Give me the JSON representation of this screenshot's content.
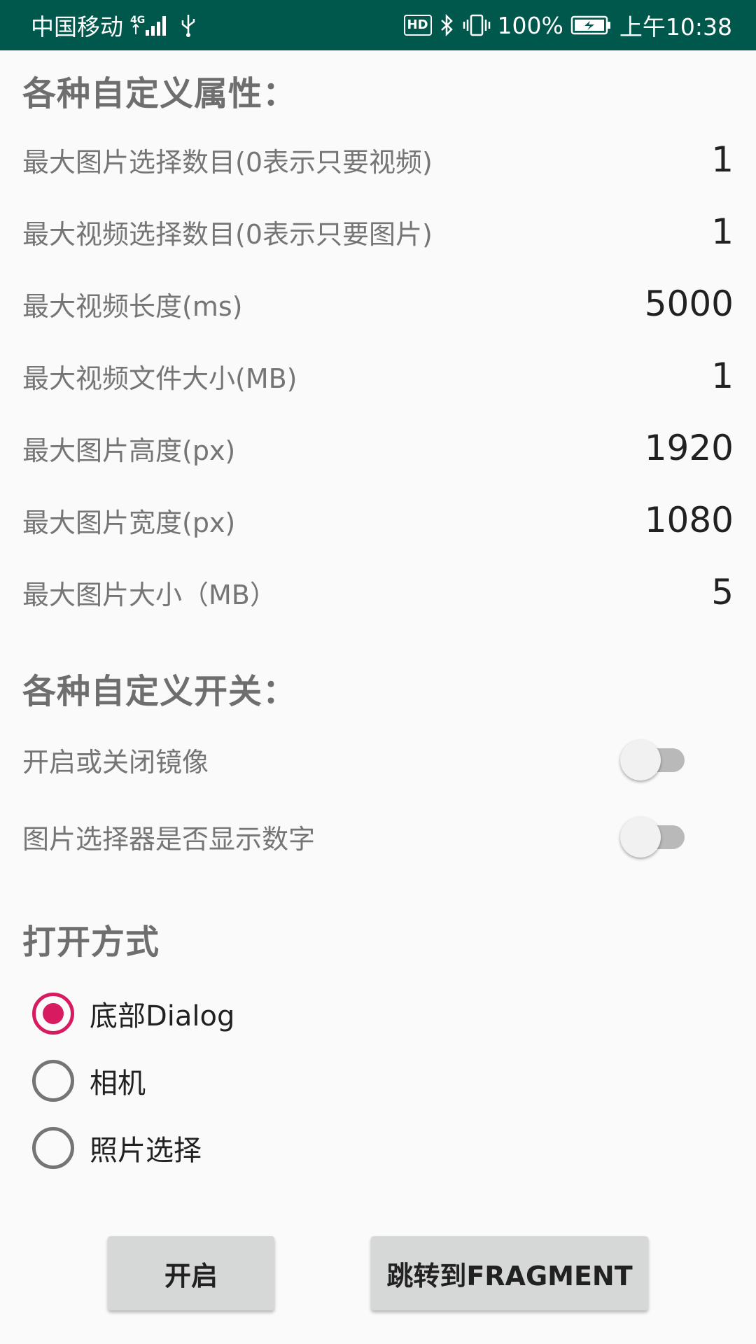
{
  "status_bar": {
    "carrier": "中国移动",
    "network_badge": "4G",
    "battery_percent": "100%",
    "time": "上午10:38",
    "hd_label": "HD"
  },
  "custom_attributes": {
    "title": "各种自定义属性：",
    "rows": [
      {
        "label": "最大图片选择数目(0表示只要视频)",
        "value": "1"
      },
      {
        "label": "最大视频选择数目(0表示只要图片)",
        "value": "1"
      },
      {
        "label": "最大视频长度(ms)",
        "value": "5000"
      },
      {
        "label": "最大视频文件大小(MB)",
        "value": "1"
      },
      {
        "label": "最大图片高度(px)",
        "value": "1920"
      },
      {
        "label": "最大图片宽度(px)",
        "value": "1080"
      },
      {
        "label": "最大图片大小（MB）",
        "value": "5"
      }
    ]
  },
  "custom_switches": {
    "title": "各种自定义开关：",
    "items": [
      {
        "label": "开启或关闭镜像",
        "checked": false
      },
      {
        "label": "图片选择器是否显示数字",
        "checked": false
      }
    ]
  },
  "open_mode": {
    "title": "打开方式",
    "options": [
      {
        "label": "底部Dialog",
        "checked": true
      },
      {
        "label": "相机",
        "checked": false
      },
      {
        "label": "照片选择",
        "checked": false
      }
    ]
  },
  "buttons": {
    "start": "开启",
    "fragment": "跳转到FRAGMENT"
  },
  "colors": {
    "status_bar": "#00574b",
    "accent": "#d81b60"
  }
}
